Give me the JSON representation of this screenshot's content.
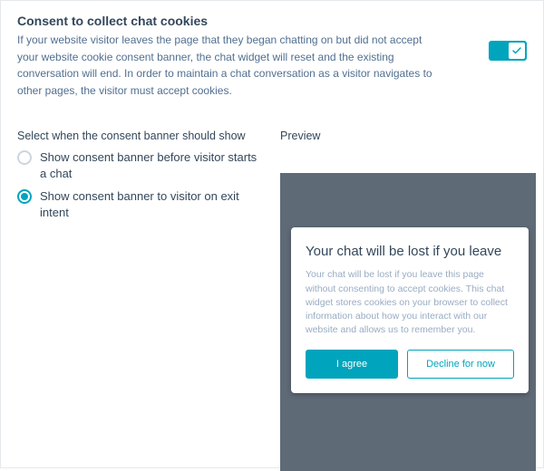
{
  "section": {
    "title": "Consent to collect chat cookies",
    "description": "If your website visitor leaves the page that they began chatting on but did not accept your website cookie consent banner, the chat widget will reset and the existing conversation will end. In order to maintain a chat conversation as a visitor navigates to other pages, the visitor must accept cookies."
  },
  "toggle": {
    "enabled": true
  },
  "radio": {
    "label": "Select when the consent banner should show",
    "options": [
      {
        "label": "Show consent banner before visitor starts a chat",
        "selected": false
      },
      {
        "label": "Show consent banner to visitor on exit intent",
        "selected": true
      }
    ]
  },
  "preview": {
    "label": "Preview",
    "modal": {
      "title": "Your chat will be lost if you leave",
      "body": "Your chat will be lost if you leave this page without consenting to accept cookies. This chat widget stores cookies on your browser to collect information about how you interact with our website and allows us to remember you.",
      "primary": "I agree",
      "secondary": "Decline for now"
    }
  }
}
